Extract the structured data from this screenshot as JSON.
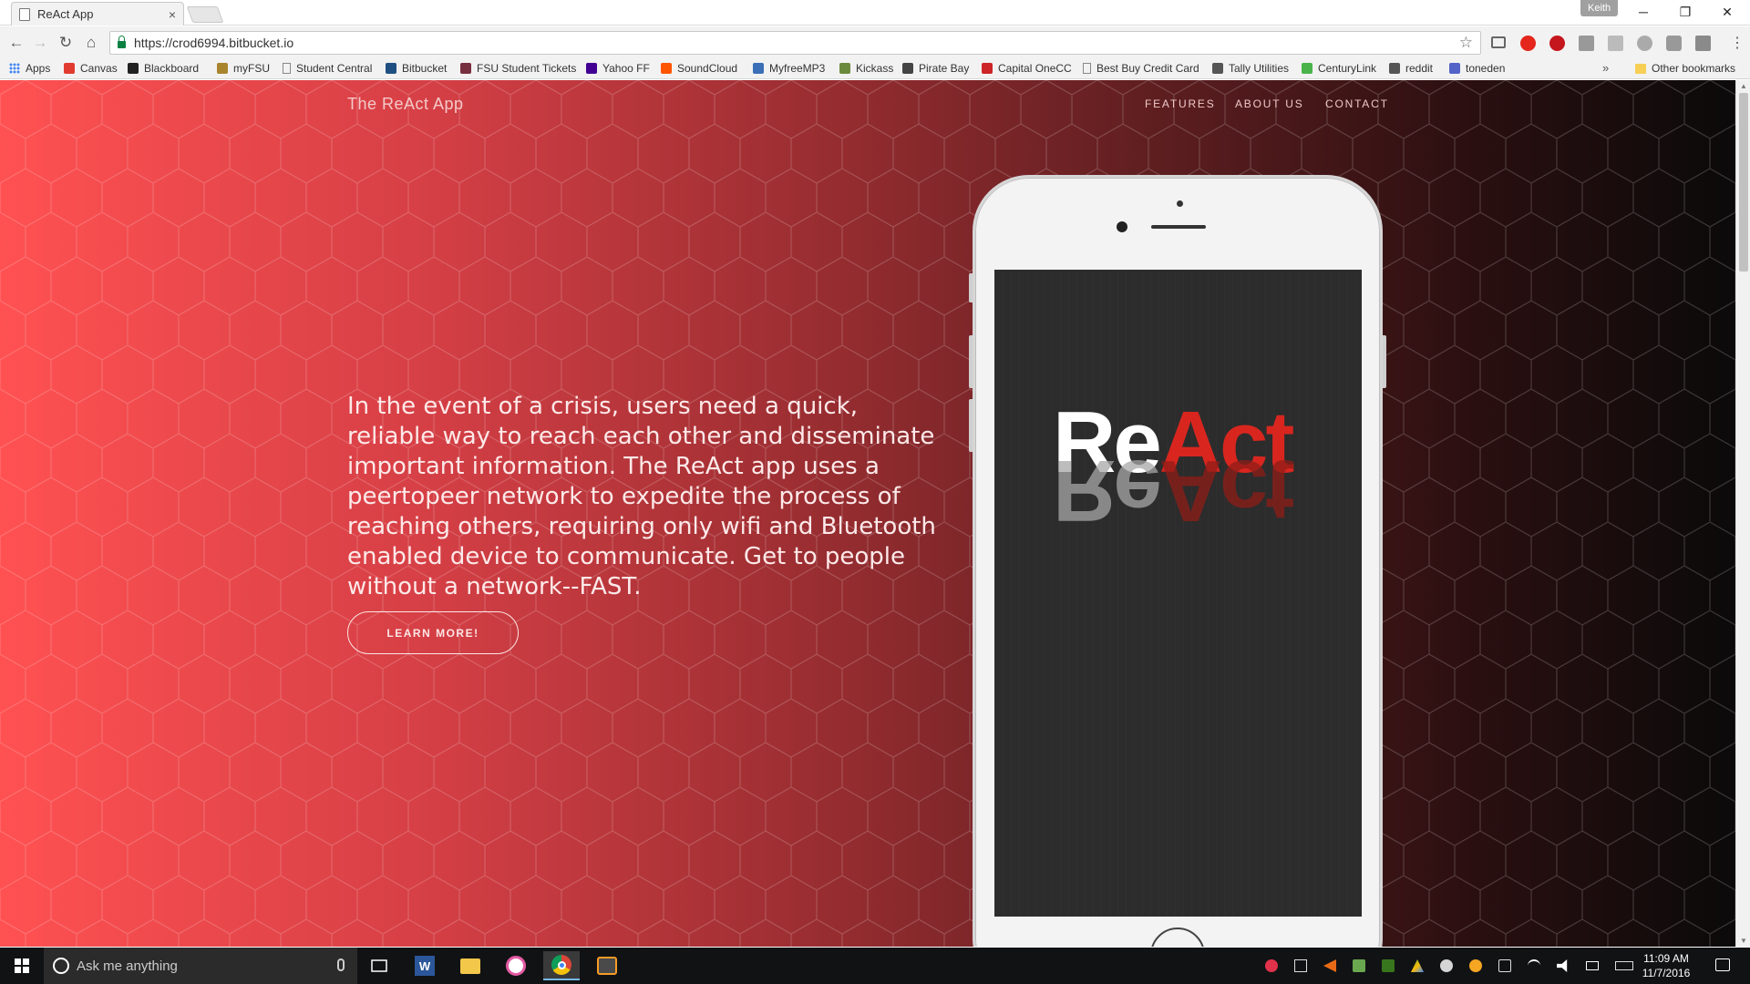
{
  "browser": {
    "tab_title": "ReAct App",
    "tab_close": "×",
    "profile_name": "Keith",
    "url": "https://crod6994.bitbucket.io",
    "window_controls": {
      "minimize": "─",
      "maximize": "❐",
      "close": "✕"
    },
    "nav": {
      "back": "←",
      "forward": "→",
      "reload": "↻",
      "home": "⌂",
      "star": "☆",
      "menu": "⋮"
    }
  },
  "bookmarks": {
    "items": [
      {
        "label": "Apps",
        "icon": "apps-grid-icon",
        "color": "#4285f4"
      },
      {
        "label": "Canvas",
        "icon": "canvas-icon",
        "color": "#e13b2f"
      },
      {
        "label": "Blackboard",
        "icon": "blackboard-icon",
        "color": "#222222"
      },
      {
        "label": "myFSU",
        "icon": "myfsu-icon",
        "color": "#a8842c"
      },
      {
        "label": "Student Central",
        "icon": "page-icon",
        "color": "#888888"
      },
      {
        "label": "Bitbucket",
        "icon": "bitbucket-icon",
        "color": "#205081"
      },
      {
        "label": "FSU Student Tickets",
        "icon": "fsu-tickets-icon",
        "color": "#782f40"
      },
      {
        "label": "Yahoo FF",
        "icon": "yahoo-icon",
        "color": "#410093"
      },
      {
        "label": "SoundCloud",
        "icon": "soundcloud-icon",
        "color": "#ff5500"
      },
      {
        "label": "MyfreeMP3",
        "icon": "myfreemp3-icon",
        "color": "#3b6fb6"
      },
      {
        "label": "Kickass",
        "icon": "kickass-icon",
        "color": "#6c8a3c"
      },
      {
        "label": "Pirate Bay",
        "icon": "pirate-bay-icon",
        "color": "#444444"
      },
      {
        "label": "Capital OneCC",
        "icon": "capital-one-icon",
        "color": "#cc2427"
      },
      {
        "label": "Best Buy Credit Card",
        "icon": "page-icon",
        "color": "#888888"
      },
      {
        "label": "Tally Utilities",
        "icon": "tally-icon",
        "color": "#555555"
      },
      {
        "label": "CenturyLink",
        "icon": "centurylink-icon",
        "color": "#4ab34a"
      },
      {
        "label": "reddit",
        "icon": "reddit-icon",
        "color": "#555555"
      },
      {
        "label": "toneden",
        "icon": "toneden-icon",
        "color": "#5463c8"
      }
    ],
    "more": "»",
    "other": "Other bookmarks"
  },
  "page": {
    "brand": "The ReAct App",
    "nav": {
      "features": "FEATURES",
      "about": "ABOUT US",
      "contact": "CONTACT"
    },
    "hero_text": "In the event of a crisis, users need a quick, reliable way to reach each other and disseminate important information. The ReAct app uses a peertopeer network to expedite the process of reaching others, requiring only wifi and Bluetooth enabled device to communicate. Get to people without a network--FAST.",
    "cta": "LEARN MORE!",
    "logo": {
      "part1": "Re",
      "part2": "Act"
    },
    "colors": {
      "logo_red": "#d8261f",
      "gradient_start": "#ff5152",
      "gradient_end": "#0b0a0a"
    }
  },
  "taskbar": {
    "search_placeholder": "Ask me anything",
    "apps": [
      "task-view",
      "word",
      "file-explorer",
      "itunes",
      "chrome",
      "sublime-text"
    ],
    "clock_time": "11:09 AM",
    "clock_date": "11/7/2016"
  }
}
